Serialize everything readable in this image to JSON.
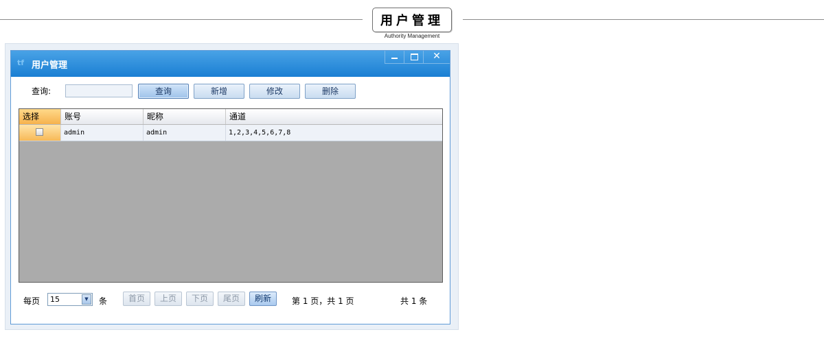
{
  "header": {
    "title": "用户管理",
    "subtitle": "Authority Management"
  },
  "window": {
    "icon_text": "tf",
    "title": "用户管理",
    "controls": {
      "minimize": "minimize",
      "maximize": "maximize",
      "close": "✕"
    }
  },
  "toolbar": {
    "query_label": "查询:",
    "query_value": "",
    "buttons": {
      "query": "查询",
      "add": "新增",
      "edit": "修改",
      "delete": "删除"
    }
  },
  "grid": {
    "columns": [
      "选择",
      "账号",
      "昵称",
      "通道"
    ],
    "rows": [
      {
        "selected": false,
        "account": "admin",
        "nickname": "admin",
        "channels": "1,2,3,4,5,6,7,8"
      }
    ]
  },
  "pager": {
    "per_page_label": "每页",
    "per_page_value": "15",
    "unit_label": "条",
    "buttons": {
      "first": "首页",
      "prev": "上页",
      "next": "下页",
      "last": "尾页",
      "refresh": "刷新"
    },
    "page_info": "第 1 页，共 1 页",
    "total_info": "共 1 条"
  },
  "colors": {
    "titlebar": "#1a7fd3",
    "grid_background": "#ababab",
    "selected_column": "#f6b24d"
  },
  "icons": {
    "dropdown": "chevron-down-icon",
    "minimize": "minimize-icon",
    "maximize": "maximize-icon",
    "close": "close-icon"
  }
}
